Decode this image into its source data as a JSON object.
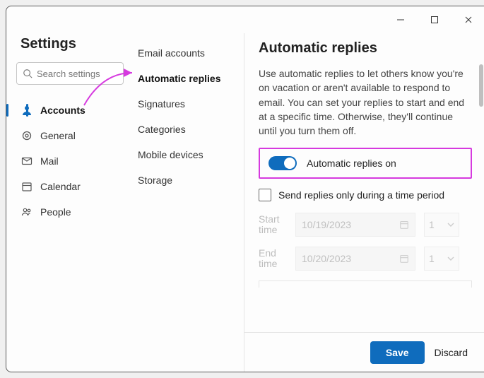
{
  "titlebar": {
    "minimize": "–",
    "maximize": "▢",
    "close": "✕"
  },
  "sidebar": {
    "title": "Settings",
    "search_placeholder": "Search settings",
    "items": [
      {
        "label": "Accounts",
        "active": true
      },
      {
        "label": "General"
      },
      {
        "label": "Mail"
      },
      {
        "label": "Calendar"
      },
      {
        "label": "People"
      }
    ]
  },
  "subnav": {
    "items": [
      {
        "label": "Email accounts"
      },
      {
        "label": "Automatic replies",
        "active": true
      },
      {
        "label": "Signatures"
      },
      {
        "label": "Categories"
      },
      {
        "label": "Mobile devices"
      },
      {
        "label": "Storage"
      }
    ]
  },
  "panel": {
    "title": "Automatic replies",
    "description": "Use automatic replies to let others know you're on vacation or aren't available to respond to email. You can set your replies to start and end at a specific time. Otherwise, they'll continue until you turn them off.",
    "toggle_label": "Automatic replies on",
    "checkbox_label": "Send replies only during a time period",
    "start_label": "Start time",
    "end_label": "End time",
    "start_date": "10/19/2023",
    "end_date": "10/20/2023",
    "start_hour": "1",
    "end_hour": "1"
  },
  "footer": {
    "save": "Save",
    "discard": "Discard"
  }
}
